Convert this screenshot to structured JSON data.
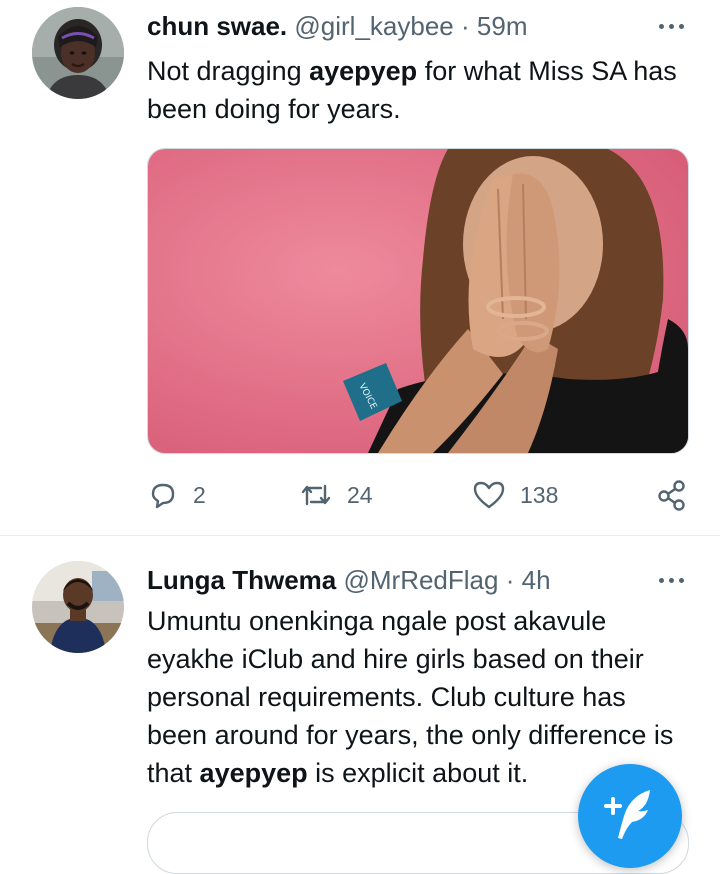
{
  "tweets": [
    {
      "author_name": "chun swae.",
      "handle": "@girl_kaybee",
      "separator": "·",
      "time": "59m",
      "text_before": "Not dragging ",
      "text_bold": "ayepyep",
      "text_after": " for what Miss SA has been doing for years.",
      "media_wristband_text": "VOICE",
      "replies": "2",
      "retweets": "24",
      "likes": "138"
    },
    {
      "author_name": "Lunga Thwema",
      "handle": "@MrRedFlag",
      "separator": "·",
      "time": "4h",
      "text_before": "Umuntu onenkinga ngale post akavule eyakhe iClub and hire girls based on their personal requirements. Club culture has been around for years, the only difference is that ",
      "text_bold": "ayepyep",
      "text_after": " is explicit about it."
    }
  ],
  "icons": {
    "more": "more-horizontal-icon",
    "reply": "reply-bubble-icon",
    "retweet": "retweet-arrows-icon",
    "like": "heart-outline-icon",
    "share": "share-nodes-icon",
    "compose": "compose-feather-icon"
  },
  "colors": {
    "text": "#0f1419",
    "secondary": "#536471",
    "accent": "#1d9bf0",
    "divider": "#e6ecf0",
    "media_background": "#e36f86"
  }
}
